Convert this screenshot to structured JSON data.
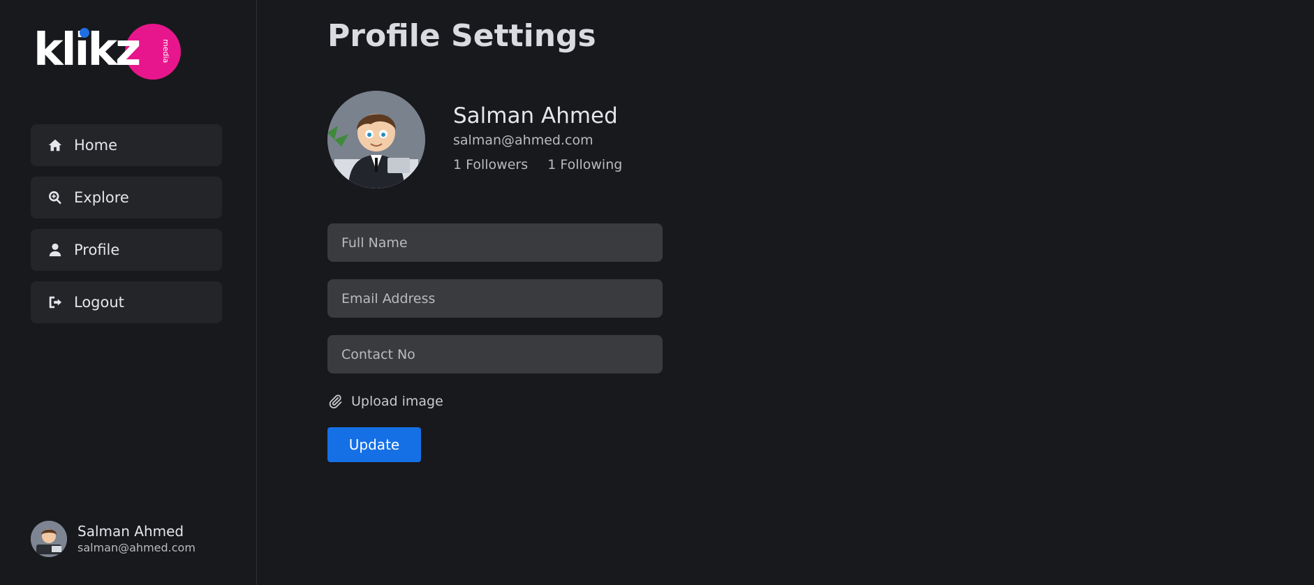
{
  "brand": {
    "logo_text": "klikz",
    "logo_sub": "media",
    "colors": {
      "pink": "#e8168c",
      "blue": "#1f6fe5"
    }
  },
  "sidebar": {
    "items": [
      {
        "label": "Home",
        "icon": "home-icon"
      },
      {
        "label": "Explore",
        "icon": "search-plus-icon"
      },
      {
        "label": "Profile",
        "icon": "user-icon"
      },
      {
        "label": "Logout",
        "icon": "logout-icon"
      }
    ],
    "user": {
      "name": "Salman Ahmed",
      "email": "salman@ahmed.com"
    }
  },
  "main": {
    "title": "Profile Settings",
    "profile": {
      "name": "Salman Ahmed",
      "email": "salman@ahmed.com",
      "followers": "1 Followers",
      "following": "1 Following"
    },
    "form": {
      "full_name_placeholder": "Full Name",
      "email_placeholder": "Email Address",
      "contact_placeholder": "Contact No",
      "upload_label": "Upload image",
      "update_label": "Update"
    }
  },
  "colors": {
    "accent": "#1570e6",
    "background": "#18191c",
    "card": "#242528",
    "input": "#3a3b3e"
  }
}
